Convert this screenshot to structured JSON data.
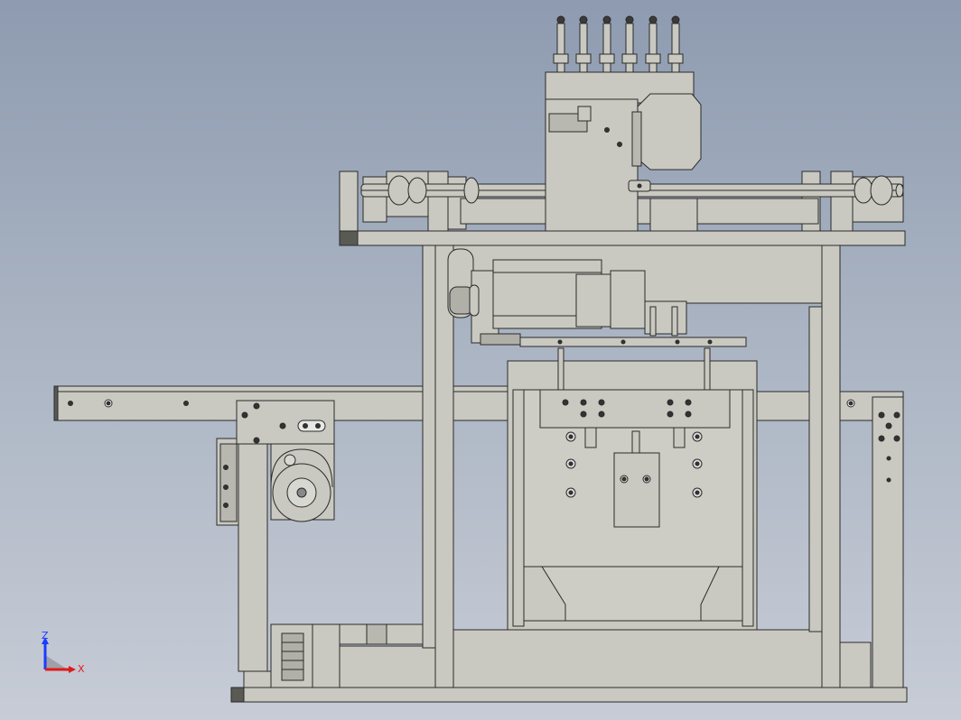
{
  "viewport": {
    "background_top": "#8e9bb0",
    "background_bottom": "#c7ccd6",
    "part_fill": "#c9c9c1",
    "part_fill_dark": "#a8a8a0",
    "edge_color": "#2a2a2a",
    "shadow_color": "#5a5a55"
  },
  "triad": {
    "z_label": "Z",
    "x_label": "X",
    "z_color": "#1a3cff",
    "x_color": "#e01a1a",
    "y_color": "#1aa01a"
  }
}
